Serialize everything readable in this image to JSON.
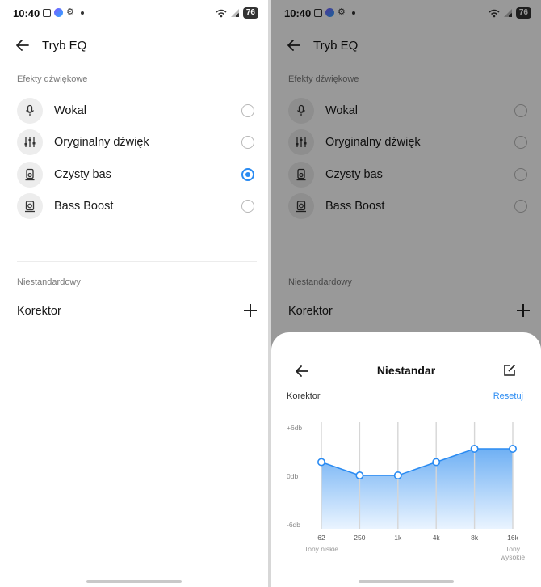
{
  "status": {
    "time": "10:40",
    "battery": "76"
  },
  "screen": {
    "title": "Tryb EQ",
    "sound_effects_label": "Efekty dźwiękowe",
    "effects": [
      {
        "label": "Wokal",
        "icon": "microphone-icon",
        "selected": false
      },
      {
        "label": "Oryginalny dźwięk",
        "icon": "sliders-icon",
        "selected": false
      },
      {
        "label": "Czysty bas",
        "icon": "speaker-icon",
        "selected": true
      },
      {
        "label": "Bass Boost",
        "icon": "speaker-boost-icon",
        "selected": false
      }
    ],
    "custom_label": "Niestandardowy",
    "equalizer_label": "Korektor"
  },
  "sheet": {
    "title": "Niestandar",
    "korektor_label": "Korektor",
    "reset_label": "Resetuj",
    "y_top_label": "+6db",
    "y_mid_label": "0db",
    "y_bottom_label": "-6db",
    "low_label": "Tony niskie",
    "high_label_line1": "Tony",
    "high_label_line2": "wysokie"
  },
  "chart_data": {
    "type": "area",
    "categories": [
      "62",
      "250",
      "1k",
      "4k",
      "8k",
      "16k"
    ],
    "values": [
      1.5,
      0,
      0,
      1.5,
      3,
      3
    ],
    "ylim": [
      -6,
      6
    ],
    "y_tick_labels": [
      "+6db",
      "0db",
      "-6db"
    ],
    "colors": {
      "fill_top": "#6fb0f4",
      "fill_bottom": "#eaf4ff",
      "line": "#2a8bf2"
    }
  }
}
